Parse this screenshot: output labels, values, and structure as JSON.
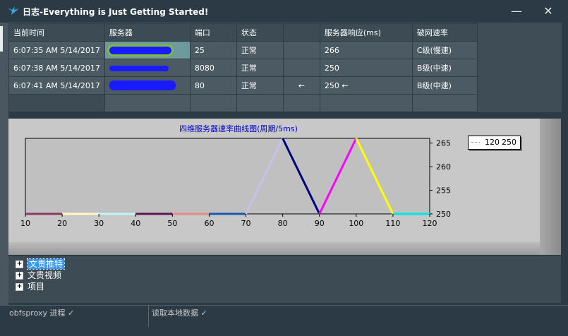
{
  "window": {
    "title": "日志-Everything is Just Getting Started!",
    "minimize_glyph": "—",
    "close_glyph": "✕"
  },
  "table": {
    "headers": [
      "当前时间",
      "服务器",
      "端口",
      "状态",
      "",
      "服务器响应(ms)",
      "破网速率"
    ],
    "rows": [
      {
        "time": "6:07:35 AM 5/14/2017",
        "server": "",
        "port": "25",
        "status": "正常",
        "arrow": "",
        "resp": "266",
        "rate": "C级(慢速)"
      },
      {
        "time": "6:07:38 AM 5/14/2017",
        "server": "",
        "port": "8080",
        "status": "正常",
        "arrow": "",
        "resp": "250",
        "rate": "B级(中速)"
      },
      {
        "time": "6:07:41 AM 5/14/2017",
        "server": "",
        "port": "80",
        "status": "正常",
        "arrow": "←",
        "resp": "250 ←",
        "rate": "B级(中速)"
      }
    ]
  },
  "chart_data": {
    "type": "line",
    "title": "四维服务器速率曲线图(周期/5ms)",
    "xlim": [
      10,
      120
    ],
    "ylim": [
      250,
      266
    ],
    "xticks": [
      10,
      20,
      30,
      40,
      50,
      60,
      70,
      80,
      90,
      100,
      110,
      120
    ],
    "yticks": [
      250,
      255,
      260,
      265
    ],
    "points": [
      {
        "x": 10,
        "y": 250
      },
      {
        "x": 20,
        "y": 250
      },
      {
        "x": 30,
        "y": 250
      },
      {
        "x": 40,
        "y": 250
      },
      {
        "x": 50,
        "y": 250
      },
      {
        "x": 60,
        "y": 250
      },
      {
        "x": 70,
        "y": 250
      },
      {
        "x": 80,
        "y": 266
      },
      {
        "x": 90,
        "y": 250
      },
      {
        "x": 100,
        "y": 266
      },
      {
        "x": 110,
        "y": 250
      },
      {
        "x": 120,
        "y": 250
      }
    ],
    "segment_colors": [
      "#8b3a62",
      "#fff8c6",
      "#c6f4f4",
      "#5a1a5a",
      "#e88a8a",
      "#1e5aa8",
      "#c8c0ec",
      "#000080",
      "#ff00ff",
      "#ffff00",
      "#00e5e5"
    ],
    "legend": {
      "x": "120",
      "y": "250"
    },
    "grid": false
  },
  "tree": {
    "items": [
      "文贵推特",
      "文贵视频",
      "项目"
    ]
  },
  "status_bar": {
    "left": "obfsproxy 进程 ✓",
    "right": "读取本地数据 ✓"
  }
}
